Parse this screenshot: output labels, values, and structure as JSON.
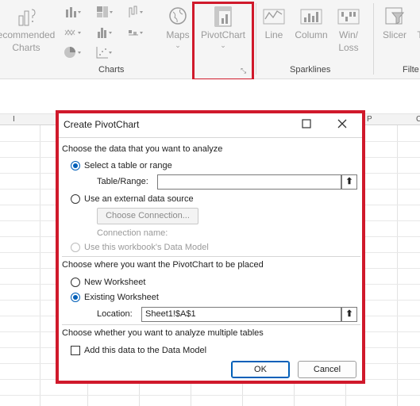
{
  "ribbon": {
    "recommended_charts": "ecommended Charts",
    "maps": "Maps",
    "pivotchart": "PivotChart",
    "line": "Line",
    "column": "Column",
    "win_loss": "Win/ Loss",
    "slicer": "Slicer",
    "timeline_fragment": "T",
    "groups": {
      "charts": "Charts",
      "sparklines": "Sparklines",
      "filters": "Filte"
    }
  },
  "sheet": {
    "columns": [
      "I",
      "P",
      "C"
    ]
  },
  "dialog": {
    "title": "Create PivotChart",
    "section_data": "Choose the data that you want to analyze",
    "select_table": "Select a table or range",
    "table_range_label": "Table/Range:",
    "table_range_value": "",
    "external_source": "Use an external data source",
    "choose_connection": "Choose Connection...",
    "connection_name": "Connection name:",
    "data_model": "Use this workbook's Data Model",
    "section_place": "Choose where you want the PivotChart to be placed",
    "new_worksheet": "New Worksheet",
    "existing_worksheet": "Existing Worksheet",
    "location_label": "Location:",
    "location_value": "Sheet1!$A$1",
    "section_multi": "Choose whether you want to analyze multiple tables",
    "add_data_model": "Add this data to the Data Model",
    "ok": "OK",
    "cancel": "Cancel"
  },
  "colors": {
    "highlight": "#d0192b",
    "accent": "#005fb8"
  }
}
